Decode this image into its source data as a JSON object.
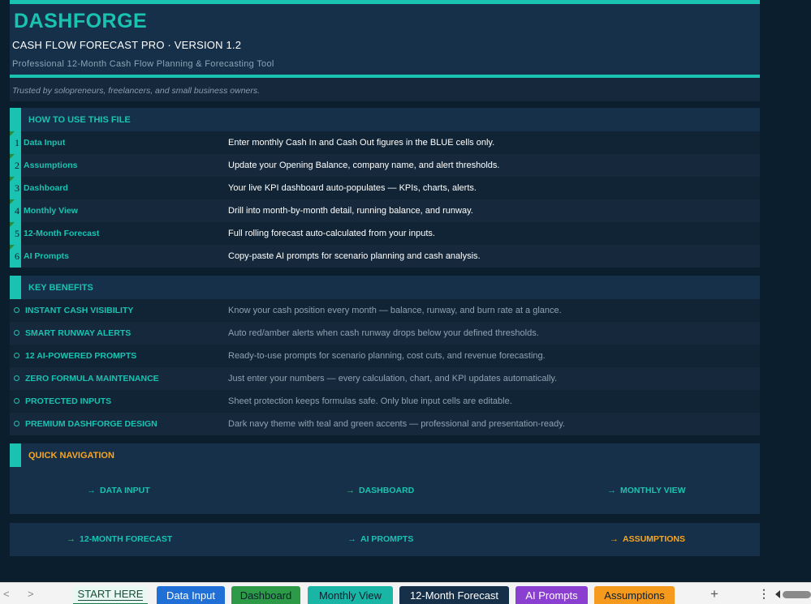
{
  "header": {
    "brand": "DASHFORGE",
    "subtitle": "CASH FLOW FORECAST PRO  ·  VERSION 1.2",
    "tagline": "Professional 12-Month Cash Flow Planning & Forecasting Tool",
    "trusted": "Trusted by solopreneurs, freelancers, and small business owners."
  },
  "how_to": {
    "title": "HOW TO USE THIS FILE",
    "steps": [
      {
        "num": "1",
        "label": "Data Input",
        "desc": "Enter monthly Cash In and Cash Out figures in the BLUE cells only."
      },
      {
        "num": "2",
        "label": "Assumptions",
        "desc": "Update your Opening Balance, company name, and alert thresholds."
      },
      {
        "num": "3",
        "label": "Dashboard",
        "desc": "Your live KPI dashboard auto-populates — KPIs, charts, alerts."
      },
      {
        "num": "4",
        "label": "Monthly View",
        "desc": "Drill into month-by-month detail, running balance, and runway."
      },
      {
        "num": "5",
        "label": "12-Month Forecast",
        "desc": "Full rolling forecast auto-calculated from your inputs."
      },
      {
        "num": "6",
        "label": "AI Prompts",
        "desc": "Copy-paste AI prompts for scenario planning and cash analysis."
      }
    ]
  },
  "benefits": {
    "title": "KEY BENEFITS",
    "items": [
      {
        "label": "INSTANT CASH VISIBILITY",
        "desc": "Know your cash position every month — balance, runway, and burn rate at a glance."
      },
      {
        "label": "SMART RUNWAY ALERTS",
        "desc": "Auto red/amber alerts when cash runway drops below your defined thresholds."
      },
      {
        "label": "12 AI-POWERED PROMPTS",
        "desc": "Ready-to-use prompts for scenario planning, cost cuts, and revenue forecasting."
      },
      {
        "label": "ZERO FORMULA MAINTENANCE",
        "desc": "Just enter your numbers — every calculation, chart, and KPI updates automatically."
      },
      {
        "label": "PROTECTED INPUTS",
        "desc": "Sheet protection keeps formulas safe. Only blue input cells are editable."
      },
      {
        "label": "PREMIUM DASHFORGE DESIGN",
        "desc": "Dark navy theme with teal and green accents — professional and presentation-ready."
      }
    ]
  },
  "navigation": {
    "title": "QUICK NAVIGATION",
    "row1": [
      "DATA INPUT",
      "DASHBOARD",
      "MONTHLY VIEW"
    ],
    "row2": [
      "12-MONTH FORECAST",
      "AI PROMPTS",
      "ASSUMPTIONS"
    ],
    "arrow": "→"
  },
  "tabs": {
    "prev": "<",
    "next": ">",
    "add": "+",
    "more": "⋮",
    "items": [
      {
        "label": "START HERE",
        "color": "#e8f7f1"
      },
      {
        "label": "Data Input",
        "color": "#1f6fd6"
      },
      {
        "label": "Dashboard",
        "color": "#2c9a46"
      },
      {
        "label": "Monthly View",
        "color": "#19b5a5"
      },
      {
        "label": "12-Month Forecast",
        "color": "#17304a"
      },
      {
        "label": "AI Prompts",
        "color": "#8a3fd1"
      },
      {
        "label": "Assumptions",
        "color": "#f59a1c"
      }
    ]
  },
  "colors": {
    "teal": "#19c2b1",
    "navy": "#17304a",
    "orange": "#f5a623",
    "green": "#2ecc71"
  }
}
